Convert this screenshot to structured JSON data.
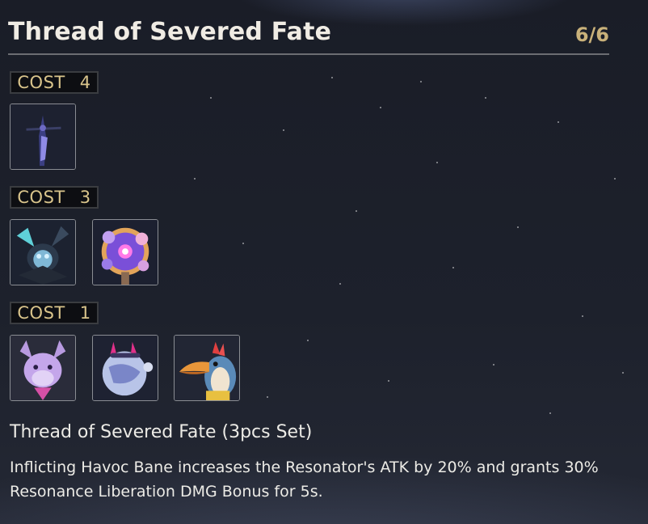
{
  "header": {
    "title": "Thread of Severed Fate",
    "count": "6/6"
  },
  "groups": [
    {
      "cost_label": "COST",
      "cost_value": "4",
      "echo_icons": [
        "dark-sword-echo-icon"
      ]
    },
    {
      "cost_label": "COST",
      "cost_value": "3",
      "echo_icons": [
        "horned-spirit-echo-icon",
        "glowing-flower-echo-icon"
      ]
    },
    {
      "cost_label": "COST",
      "cost_value": "1",
      "echo_icons": [
        "purple-dragon-echo-icon",
        "orb-creature-echo-icon",
        "toucan-bird-echo-icon"
      ]
    }
  ],
  "set_bonus": {
    "name": "Thread of Severed Fate (3pcs Set)",
    "description": "Inflicting Havoc Bane increases the Resonator's ATK by 20% and grants 30% Resonance Liberation DMG Bonus for 5s."
  }
}
